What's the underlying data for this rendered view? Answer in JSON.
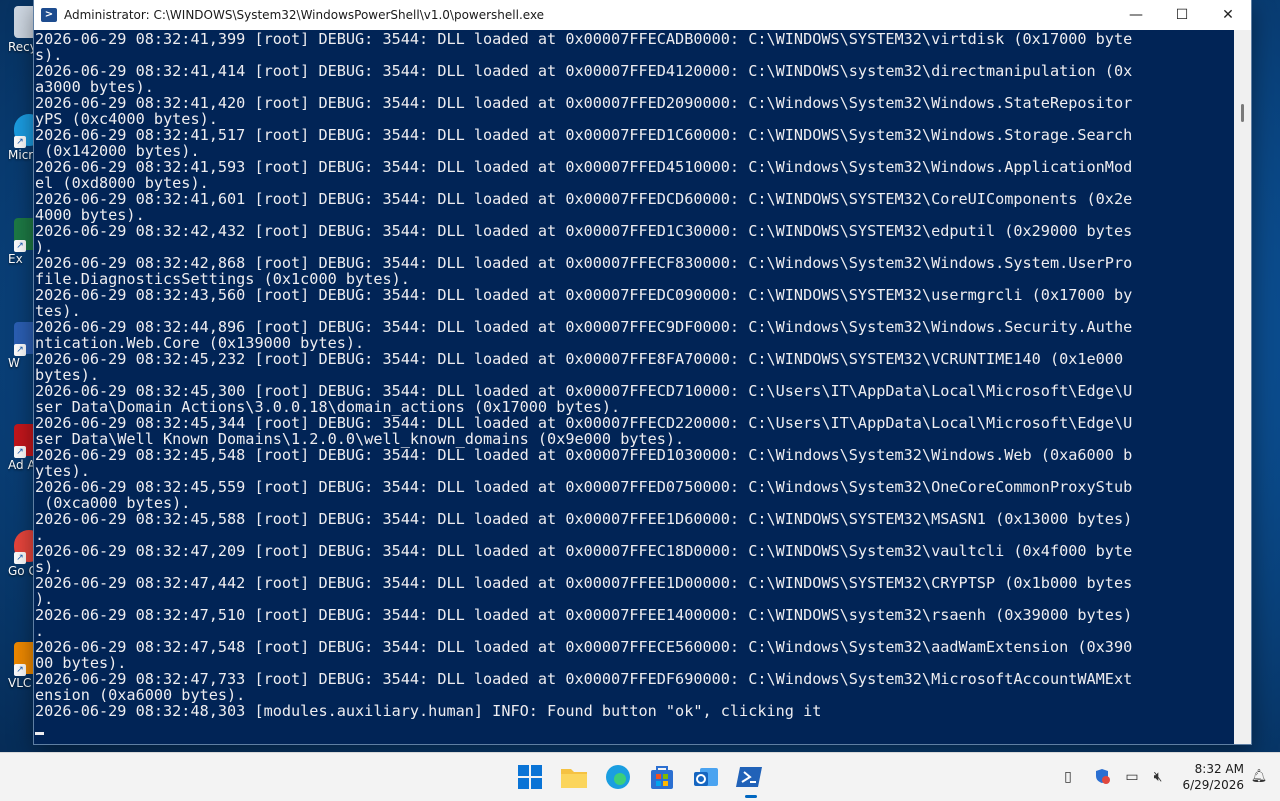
{
  "desktop": {
    "icons": [
      {
        "label": "Recy"
      },
      {
        "label": "Micr Edi"
      },
      {
        "label": "Ex"
      },
      {
        "label": "W"
      },
      {
        "label": "Ad Acr"
      },
      {
        "label": "Go Chr"
      },
      {
        "label": "VLC pl"
      }
    ]
  },
  "window": {
    "title": "Administrator: C:\\WINDOWS\\System32\\WindowsPowerShell\\v1.0\\powershell.exe",
    "minimize": "—",
    "maximize": "☐",
    "close": "✕"
  },
  "console": {
    "lines": [
      "2026-06-29 08:32:41,399 [root] DEBUG: 3544: DLL loaded at 0x00007FFECADB0000: C:\\WINDOWS\\SYSTEM32\\virtdisk (0x17000 byte",
      "s).",
      "2026-06-29 08:32:41,414 [root] DEBUG: 3544: DLL loaded at 0x00007FFED4120000: C:\\WINDOWS\\system32\\directmanipulation (0x",
      "a3000 bytes).",
      "2026-06-29 08:32:41,420 [root] DEBUG: 3544: DLL loaded at 0x00007FFED2090000: C:\\Windows\\System32\\Windows.StateRepositor",
      "yPS (0xc4000 bytes).",
      "2026-06-29 08:32:41,517 [root] DEBUG: 3544: DLL loaded at 0x00007FFED1C60000: C:\\WINDOWS\\System32\\Windows.Storage.Search",
      " (0x142000 bytes).",
      "2026-06-29 08:32:41,593 [root] DEBUG: 3544: DLL loaded at 0x00007FFED4510000: C:\\Windows\\System32\\Windows.ApplicationMod",
      "el (0xd8000 bytes).",
      "2026-06-29 08:32:41,601 [root] DEBUG: 3544: DLL loaded at 0x00007FFEDCD60000: C:\\WINDOWS\\SYSTEM32\\CoreUIComponents (0x2e",
      "4000 bytes).",
      "2026-06-29 08:32:42,432 [root] DEBUG: 3544: DLL loaded at 0x00007FFED1C30000: C:\\WINDOWS\\SYSTEM32\\edputil (0x29000 bytes",
      ").",
      "2026-06-29 08:32:42,868 [root] DEBUG: 3544: DLL loaded at 0x00007FFECF830000: C:\\Windows\\System32\\Windows.System.UserPro",
      "file.DiagnosticsSettings (0x1c000 bytes).",
      "2026-06-29 08:32:43,560 [root] DEBUG: 3544: DLL loaded at 0x00007FFEDC090000: C:\\WINDOWS\\SYSTEM32\\usermgrcli (0x17000 by",
      "tes).",
      "2026-06-29 08:32:44,896 [root] DEBUG: 3544: DLL loaded at 0x00007FFEC9DF0000: C:\\Windows\\System32\\Windows.Security.Authe",
      "ntication.Web.Core (0x139000 bytes).",
      "2026-06-29 08:32:45,232 [root] DEBUG: 3544: DLL loaded at 0x00007FFE8FA70000: C:\\WINDOWS\\SYSTEM32\\VCRUNTIME140 (0x1e000 ",
      "bytes).",
      "2026-06-29 08:32:45,300 [root] DEBUG: 3544: DLL loaded at 0x00007FFECD710000: C:\\Users\\IT\\AppData\\Local\\Microsoft\\Edge\\U",
      "ser Data\\Domain Actions\\3.0.0.18\\domain_actions (0x17000 bytes).",
      "2026-06-29 08:32:45,344 [root] DEBUG: 3544: DLL loaded at 0x00007FFECD220000: C:\\Users\\IT\\AppData\\Local\\Microsoft\\Edge\\U",
      "ser Data\\Well Known Domains\\1.2.0.0\\well_known_domains (0x9e000 bytes).",
      "2026-06-29 08:32:45,548 [root] DEBUG: 3544: DLL loaded at 0x00007FFED1030000: C:\\Windows\\System32\\Windows.Web (0xa6000 b",
      "ytes).",
      "2026-06-29 08:32:45,559 [root] DEBUG: 3544: DLL loaded at 0x00007FFED0750000: C:\\Windows\\System32\\OneCoreCommonProxyStub",
      " (0xca000 bytes).",
      "2026-06-29 08:32:45,588 [root] DEBUG: 3544: DLL loaded at 0x00007FFEE1D60000: C:\\WINDOWS\\SYSTEM32\\MSASN1 (0x13000 bytes)",
      ".",
      "2026-06-29 08:32:47,209 [root] DEBUG: 3544: DLL loaded at 0x00007FFEC18D0000: C:\\WINDOWS\\System32\\vaultcli (0x4f000 byte",
      "s).",
      "2026-06-29 08:32:47,442 [root] DEBUG: 3544: DLL loaded at 0x00007FFEE1D00000: C:\\WINDOWS\\SYSTEM32\\CRYPTSP (0x1b000 bytes",
      ").",
      "2026-06-29 08:32:47,510 [root] DEBUG: 3544: DLL loaded at 0x00007FFEE1400000: C:\\WINDOWS\\system32\\rsaenh (0x39000 bytes)",
      ".",
      "2026-06-29 08:32:47,548 [root] DEBUG: 3544: DLL loaded at 0x00007FFECE560000: C:\\Windows\\System32\\aadWamExtension (0x390",
      "00 bytes).",
      "2026-06-29 08:32:47,733 [root] DEBUG: 3544: DLL loaded at 0x00007FFEDF690000: C:\\Windows\\System32\\MicrosoftAccountWAMExt",
      "ension (0xa6000 bytes).",
      "2026-06-29 08:32:48,303 [modules.auxiliary.human] INFO: Found button \"ok\", clicking it"
    ]
  },
  "taskbar": {
    "apps": [
      "start-button",
      "file-explorer",
      "microsoft-edge",
      "microsoft-store",
      "outlook",
      "windows-powershell"
    ],
    "clock_time": "8:32 AM",
    "clock_date": "6/29/2026"
  },
  "colors": {
    "console_bg": "#012456",
    "console_fg": "#eeedf0",
    "taskbar_bg": "#f3f3f3",
    "accent": "#0067c0"
  }
}
